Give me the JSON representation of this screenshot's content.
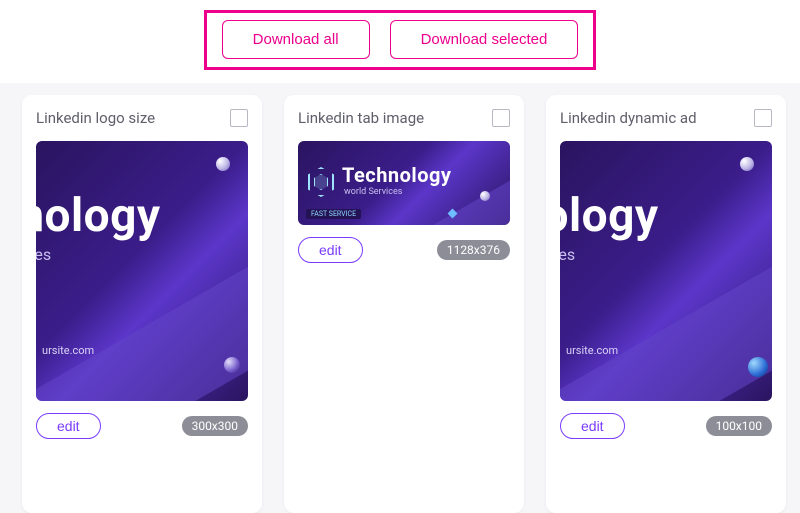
{
  "toolbar": {
    "download_all": "Download all",
    "download_selected": "Download selected"
  },
  "cards": [
    {
      "title": "Linkedin logo size",
      "dimensions": "300x300",
      "edit_label": "edit",
      "thumb_text_main": "hnology",
      "thumb_text_sub": "ces",
      "thumb_text_site": "ursite.com"
    },
    {
      "title": "Linkedin tab image",
      "dimensions": "1128x376",
      "edit_label": "edit",
      "thumb_text_main": "Technology",
      "thumb_text_sub": "world Services",
      "thumb_tag": "FAST SERVICE"
    },
    {
      "title": "Linkedin dynamic ad",
      "dimensions": "100x100",
      "edit_label": "edit",
      "thumb_text_main": "hnology",
      "thumb_text_sub": "ces",
      "thumb_text_site": "ursite.com"
    }
  ]
}
